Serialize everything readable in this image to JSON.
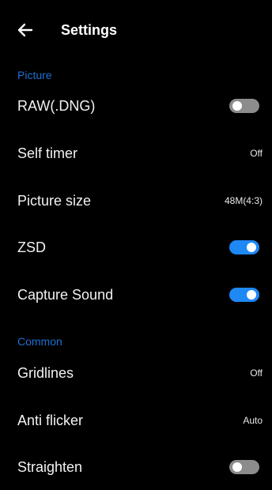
{
  "header": {
    "back_icon": "back-arrow-icon",
    "title": "Settings"
  },
  "colors": {
    "background": "#000000",
    "section_header": "#1f6fd1",
    "toggle_on": "#1e88f5",
    "toggle_off": "#8c8c8c",
    "text": "#f2f2f2"
  },
  "sections": [
    {
      "title": "Picture",
      "items": [
        {
          "label": "RAW(.DNG)",
          "type": "toggle",
          "checked": false
        },
        {
          "label": "Self timer",
          "type": "value",
          "value": "Off"
        },
        {
          "label": "Picture size",
          "type": "value",
          "value": "48M(4:3)"
        },
        {
          "label": "ZSD",
          "type": "toggle",
          "checked": true
        },
        {
          "label": "Capture Sound",
          "type": "toggle",
          "checked": true
        }
      ]
    },
    {
      "title": "Common",
      "items": [
        {
          "label": "Gridlines",
          "type": "value",
          "value": "Off"
        },
        {
          "label": "Anti flicker",
          "type": "value",
          "value": "Auto"
        },
        {
          "label": "Straighten",
          "type": "toggle",
          "checked": false
        }
      ]
    }
  ]
}
